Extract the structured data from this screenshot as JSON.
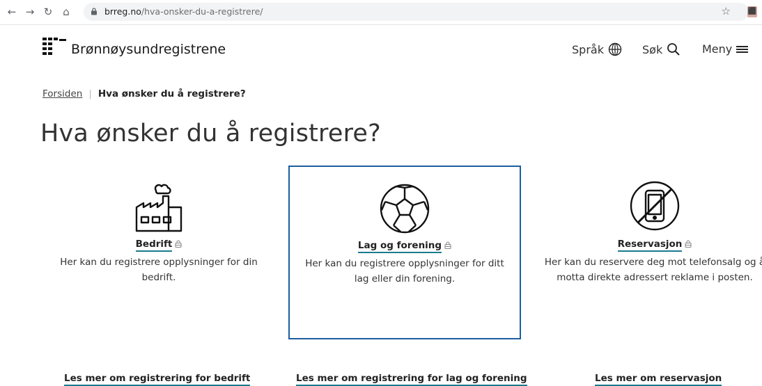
{
  "browser": {
    "url_host": "brreg.no",
    "url_path": "/hva-onsker-du-a-registrere/"
  },
  "site": {
    "name": "Brønnøysundregistrene",
    "nav": {
      "language": "Språk",
      "search": "Søk",
      "menu": "Meny"
    }
  },
  "breadcrumb": {
    "home": "Forsiden",
    "current": "Hva ønsker du å registrere?"
  },
  "page": {
    "title": "Hva ønsker du å registrere?"
  },
  "cards": [
    {
      "title": "Bedrift",
      "description": "Her kan du registrere opplysninger for din bedrift.",
      "icon": "factory-icon",
      "more_link": "Les mer om registrering for bedrift"
    },
    {
      "title": "Lag og forening",
      "description": "Her kan du registrere opplysninger for ditt lag eller din forening.",
      "icon": "football-icon",
      "more_link": "Les mer om registrering for lag og forening"
    },
    {
      "title": "Reservasjon",
      "description": "Her kan du reservere deg mot telefonsalg og å motta direkte adressert reklame i posten.",
      "icon": "no-phone-icon",
      "more_link": "Les mer om reservasjon"
    }
  ],
  "colors": {
    "accent_border": "#1b5e9e",
    "link_underline": "#1b7a8c"
  }
}
